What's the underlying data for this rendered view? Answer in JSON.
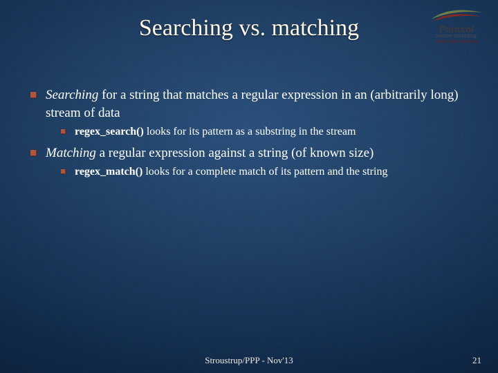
{
  "title": "Searching vs. matching",
  "logo": {
    "brand": "Parasol",
    "tag1": "Smarter computing.",
    "tag2": "Texas A&M University"
  },
  "bullets": {
    "b1_kw": "Searching",
    "b1_rest": " for a string that matches a regular expression in an (arbitrarily long) stream of data",
    "b1_sub_bold": "regex_search()",
    "b1_sub_rest": " looks for its pattern as a substring in the stream",
    "b2_kw": "Matching",
    "b2_rest": " a regular expression against a string (of known size)",
    "b2_sub_bold": "regex_match()",
    "b2_sub_rest": " looks for a complete match of its pattern and the string"
  },
  "footer": "Stroustrup/PPP - Nov'13",
  "page": "21"
}
